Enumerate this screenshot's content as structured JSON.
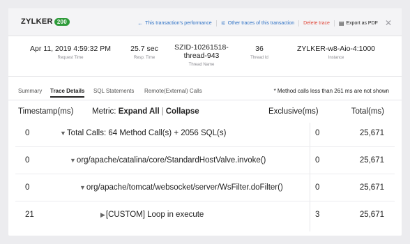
{
  "header": {
    "logo_text": "ZYLKER",
    "logo_badge": "200",
    "nav": {
      "performance_label": "This transaction's performance",
      "other_traces_label": "Other traces of this transaction",
      "delete_label": "Delete trace",
      "export_label": "Export as PDF",
      "close_glyph": "✕"
    }
  },
  "info": {
    "request_time": {
      "value": "Apr 11, 2019 4:59:32 PM",
      "label": "Request Time"
    },
    "resp_time": {
      "value": "25.7 sec",
      "label": "Resp. Time"
    },
    "thread_name": {
      "value_line1": "SZID-10261518-",
      "value_line2": "thread-943",
      "label": "Thread Name"
    },
    "thread_id": {
      "value": "36",
      "label": "Thread Id"
    },
    "instance": {
      "value": "ZYLKER-w8-Aio-4:1000",
      "label": "Instance"
    }
  },
  "tabs": [
    {
      "label": "Summary",
      "active": false
    },
    {
      "label": "Trace Details",
      "active": true
    },
    {
      "label": "SQL Statements",
      "active": false
    },
    {
      "label": "Remote(External) Calls",
      "active": false
    }
  ],
  "tab_note": "* Method calls less than 261 ms are not shown",
  "table": {
    "headers": {
      "timestamp": "Timestamp(ms)",
      "metric_prefix": "Metric:",
      "expand_all": "Expand All",
      "collapse": "Collapse",
      "exclusive": "Exclusive(ms)",
      "total": "Total(ms)"
    },
    "rows": [
      {
        "timestamp": "0",
        "arrow": "▼",
        "name": "Total Calls: 64 Method Call(s) + 2056 SQL(s)",
        "exclusive": "0",
        "total": "25,671"
      },
      {
        "timestamp": "0",
        "arrow": "▼",
        "name": "org/apache/catalina/core/StandardHostValve.invoke()",
        "exclusive": "0",
        "total": "25,671"
      },
      {
        "timestamp": "0",
        "arrow": "▼",
        "name": "org/apache/tomcat/websocket/server/WsFilter.doFilter()",
        "exclusive": "0",
        "total": "25,671"
      },
      {
        "timestamp": "21",
        "arrow": "▶",
        "name": "[CUSTOM] Loop in execute",
        "exclusive": "3",
        "total": "25,671"
      }
    ]
  }
}
